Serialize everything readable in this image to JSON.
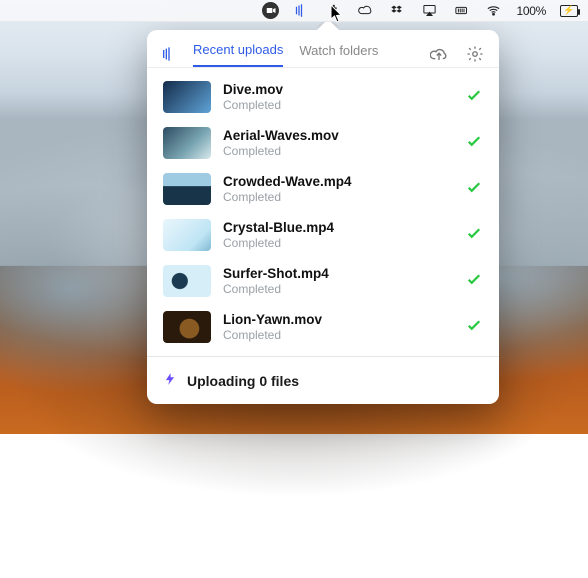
{
  "menubar": {
    "battery_percent": "100%"
  },
  "popover": {
    "tabs": {
      "recent": "Recent uploads",
      "watch": "Watch folders"
    },
    "items": [
      {
        "name": "Dive.mov",
        "status": "Completed"
      },
      {
        "name": "Aerial-Waves.mov",
        "status": "Completed"
      },
      {
        "name": "Crowded-Wave.mp4",
        "status": "Completed"
      },
      {
        "name": "Crystal-Blue.mp4",
        "status": "Completed"
      },
      {
        "name": "Surfer-Shot.mp4",
        "status": "Completed"
      },
      {
        "name": "Lion-Yawn.mov",
        "status": "Completed"
      }
    ],
    "footer": "Uploading 0 files"
  }
}
